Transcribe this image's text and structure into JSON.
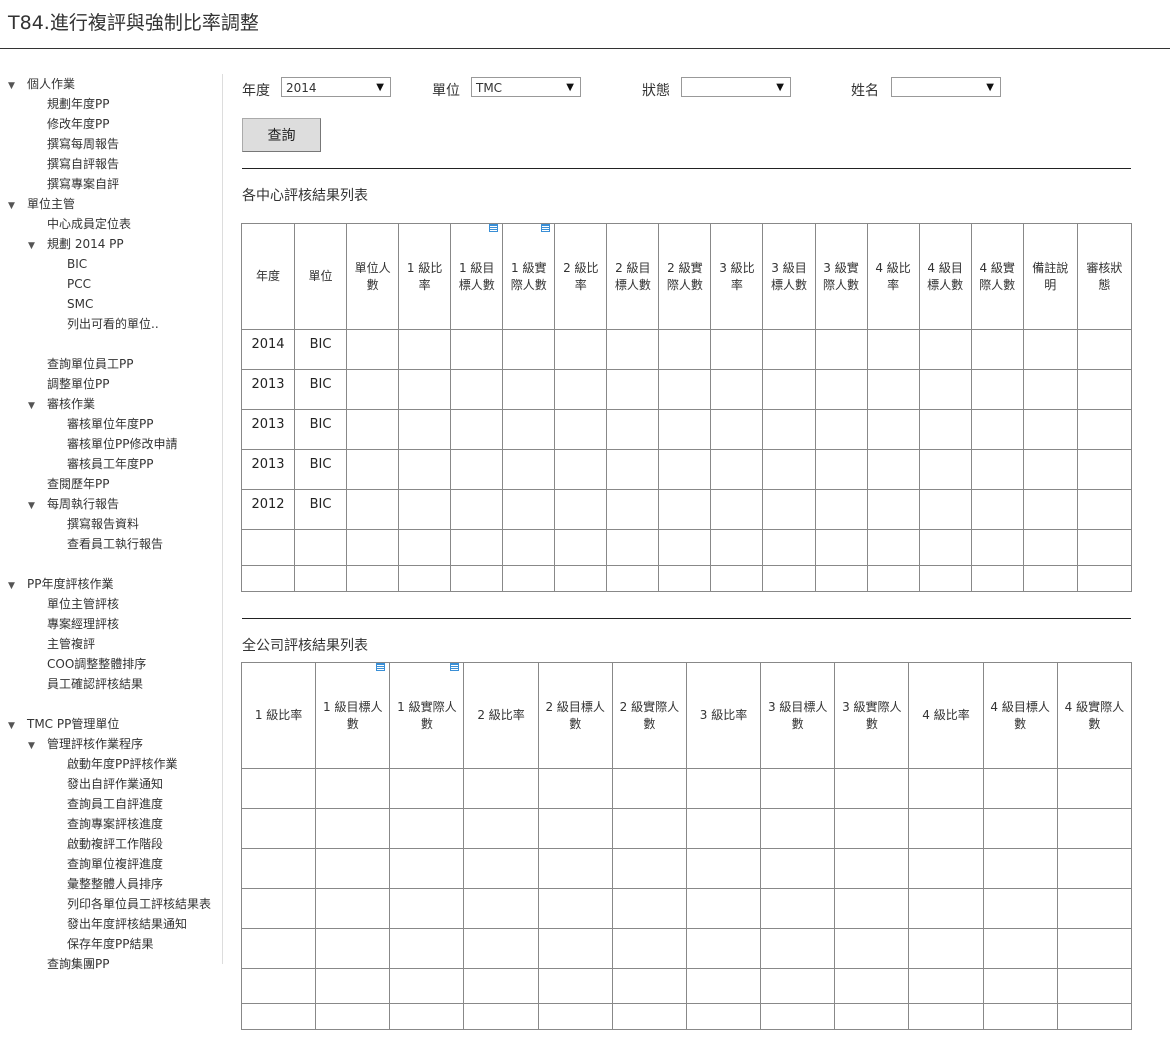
{
  "page": {
    "title": "T84.進行複評與強制比率調整"
  },
  "sidebar": {
    "items": [
      {
        "label": "個人作業",
        "level": 0,
        "toggle": "expanded"
      },
      {
        "label": "規劃年度PP",
        "level": 1
      },
      {
        "label": "修改年度PP",
        "level": 1
      },
      {
        "label": "撰寫每周報告",
        "level": 1
      },
      {
        "label": "撰寫自評報告",
        "level": 1
      },
      {
        "label": "撰寫專案自評",
        "level": 1
      },
      {
        "label": "單位主管",
        "level": 0,
        "toggle": "expanded"
      },
      {
        "label": "中心成員定位表",
        "level": 1
      },
      {
        "label": "規劃 2014 PP",
        "level": 1,
        "toggle": "expanded"
      },
      {
        "label": "BIC",
        "level": 2
      },
      {
        "label": "PCC",
        "level": 2
      },
      {
        "label": "SMC",
        "level": 2
      },
      {
        "label": "列出可看的單位..",
        "level": 2
      },
      {
        "label": "",
        "level": 1
      },
      {
        "label": "查詢單位員工PP",
        "level": 1
      },
      {
        "label": "調整單位PP",
        "level": 1
      },
      {
        "label": "審核作業",
        "level": 1,
        "toggle": "expanded"
      },
      {
        "label": "審核單位年度PP",
        "level": 2
      },
      {
        "label": "審核單位PP修改申請",
        "level": 2
      },
      {
        "label": "審核員工年度PP",
        "level": 2
      },
      {
        "label": "查閱歷年PP",
        "level": 1
      },
      {
        "label": "每周執行報告",
        "level": 1,
        "toggle": "expanded"
      },
      {
        "label": "撰寫報告資料",
        "level": 2
      },
      {
        "label": "查看員工執行報告",
        "level": 2
      },
      {
        "label": "",
        "level": 0
      },
      {
        "label": "PP年度評核作業",
        "level": 0,
        "toggle": "expanded"
      },
      {
        "label": "單位主管評核",
        "level": 1
      },
      {
        "label": "專案經理評核",
        "level": 1
      },
      {
        "label": "主管複評",
        "level": 1
      },
      {
        "label": "COO調整整體排序",
        "level": 1
      },
      {
        "label": "員工確認評核結果",
        "level": 1
      },
      {
        "label": "",
        "level": 0
      },
      {
        "label": "TMC PP管理單位",
        "level": 0,
        "toggle": "expanded"
      },
      {
        "label": "管理評核作業程序",
        "level": 1,
        "toggle": "expanded"
      },
      {
        "label": "啟動年度PP評核作業",
        "level": 2
      },
      {
        "label": "發出自評作業通知",
        "level": 2
      },
      {
        "label": "查詢員工自評進度",
        "level": 2
      },
      {
        "label": "查詢專案評核進度",
        "level": 2
      },
      {
        "label": "啟動複評工作階段",
        "level": 2
      },
      {
        "label": "查詢單位複評進度",
        "level": 2
      },
      {
        "label": "彙整整體人員排序",
        "level": 2
      },
      {
        "label": "列印各單位員工評核結果表",
        "level": 2
      },
      {
        "label": "發出年度評核結果通知",
        "level": 2
      },
      {
        "label": "保存年度PP結果",
        "level": 2
      },
      {
        "label": "查詢集團PP",
        "level": 1
      }
    ]
  },
  "filters": {
    "year_label": "年度",
    "year_value": "2014",
    "unit_label": "單位",
    "unit_value": "TMC",
    "status_label": "狀態",
    "status_value": "",
    "name_label": "姓名",
    "name_value": "",
    "query_button": "查詢"
  },
  "center_table": {
    "title": "各中心評核結果列表",
    "headers": [
      "年度",
      "單位",
      "單位人數",
      "1 級比率",
      "1 級目標人數",
      "1 級實際人數",
      "2 級比率",
      "2 級目標人數",
      "2 級實際人數",
      "3 級比率",
      "3 級目標人數",
      "3 級實際人數",
      "4 級比率",
      "4 級目標人數",
      "4 級實際人數",
      "備註說明",
      "審核狀態"
    ],
    "rows": [
      [
        "2014",
        "BIC"
      ],
      [
        "2013",
        "BIC"
      ],
      [
        "2013",
        "BIC"
      ],
      [
        "2013",
        "BIC"
      ],
      [
        "2012",
        "BIC"
      ],
      [
        "",
        ""
      ],
      [
        "",
        ""
      ]
    ]
  },
  "company_table": {
    "title": "全公司評核結果列表",
    "headers": [
      "1 級比率",
      "1 級目標人數",
      "1 級實際人數",
      "2 級比率",
      "2 級目標人數",
      "2 級實際人數",
      "3 級比率",
      "3 級目標人數",
      "3 級實際人數",
      "4 級比率",
      "4 級目標人數",
      "4 級實際人數"
    ]
  },
  "icons": {
    "note": "note-icon",
    "expanded": "triangle-down-icon",
    "select_arrow": "caret-down-icon"
  }
}
